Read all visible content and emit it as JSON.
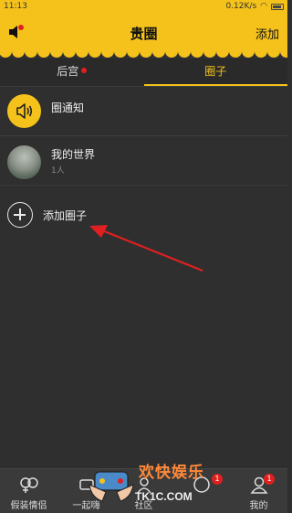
{
  "status_bar": {
    "time": "11:13",
    "speed": "0.12K/s"
  },
  "header": {
    "title": "贵圈",
    "add_label": "添加",
    "has_notification_dot": true
  },
  "tabs": [
    {
      "label": "后宫",
      "active": false,
      "has_dot": true
    },
    {
      "label": "圈子",
      "active": true,
      "has_dot": false
    }
  ],
  "list": {
    "items": [
      {
        "title": "圈通知",
        "subtitle": "",
        "icon": "speaker-icon"
      },
      {
        "title": "我的世界",
        "subtitle": "1人",
        "icon": "avatar"
      }
    ],
    "add_label": "添加圈子"
  },
  "bottom_nav": {
    "items": [
      {
        "label": "假装情侣",
        "icon": "couple-icon",
        "badge": ""
      },
      {
        "label": "一起嗨",
        "icon": "party-icon",
        "badge": ""
      },
      {
        "label": "社区",
        "icon": "community-icon",
        "badge": ""
      },
      {
        "label": "",
        "icon": "star-icon",
        "badge": "1"
      },
      {
        "label": "我的",
        "icon": "profile-icon",
        "badge": "1"
      }
    ]
  },
  "watermark": {
    "text": "欢快娱乐",
    "url": "TK1C.COM"
  },
  "colors": {
    "accent": "#f4c21b",
    "background": "#2f2f2f",
    "badge": "#e02020"
  }
}
